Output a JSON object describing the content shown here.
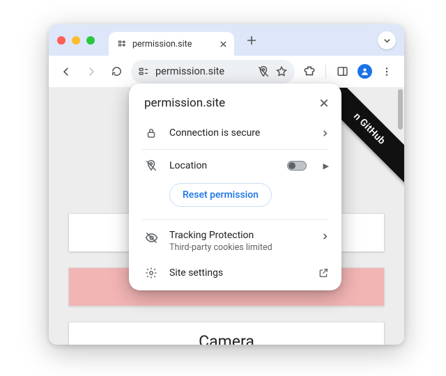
{
  "tab": {
    "title": "permission.site"
  },
  "omnibox": {
    "address": "permission.site"
  },
  "ribbon": {
    "text": "n GitHub"
  },
  "page": {
    "btn1": "",
    "btn2": "",
    "btn3": "Camera"
  },
  "popover": {
    "title": "permission.site",
    "connection": "Connection is secure",
    "location": "Location",
    "reset": "Reset permission",
    "tracking": {
      "title": "Tracking Protection",
      "sub": "Third-party cookies limited"
    },
    "settings": "Site settings"
  }
}
